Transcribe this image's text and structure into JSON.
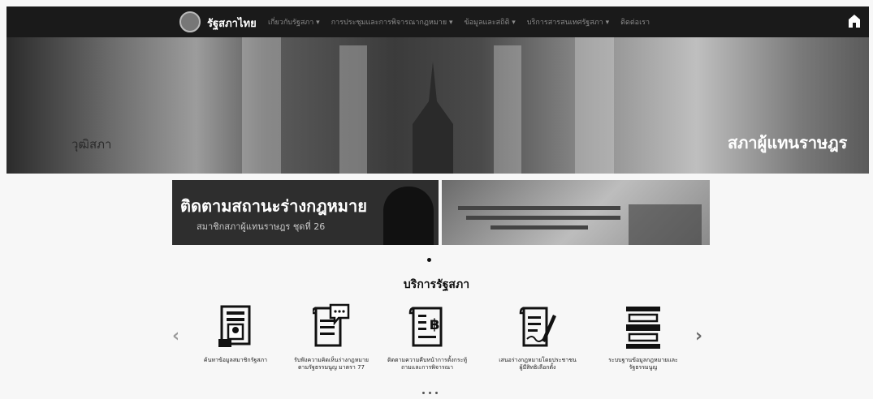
{
  "header": {
    "site_name": "รัฐสภาไทย",
    "nav": [
      "เกี่ยวกับรัฐสภา ▾",
      "การประชุมและการพิจารณากฎหมาย ▾",
      "ข้อมูลและสถิติ ▾",
      "บริการสารสนเทศรัฐสภา ▾",
      "ติดต่อเรา"
    ],
    "icons": {
      "logo": "parliament-logo-icon",
      "home": "home-icon"
    }
  },
  "hero": {
    "left_label": "วุฒิสภา",
    "right_label": "สภาผู้แทนราษฎร"
  },
  "banners": [
    {
      "title": "ติดตามสถานะร่างกฎหมาย",
      "subtitle": "สมาชิกสภาผู้แทนราษฎร ชุดที่ 26"
    },
    {
      "title": ""
    }
  ],
  "services": {
    "title": "บริการรัฐสภา",
    "items": [
      {
        "label": "ค้นหาข้อมูลสมาชิกรัฐสภา",
        "icon": "member-card-icon"
      },
      {
        "label": "รับฟังความคิดเห็นร่างกฎหมาย ตามรัฐธรรมนูญ มาตรา 77",
        "icon": "document-comment-icon"
      },
      {
        "label": "ติดตามความคืบหน้าการตั้งกระทู้ ถามและการพิจารณา",
        "icon": "document-money-icon"
      },
      {
        "label": "เสนอร่างกฎหมายโดยประชาชน ผู้มีสิทธิเลือกตั้ง",
        "icon": "document-sign-icon"
      },
      {
        "label": "ระบบฐานข้อมูลกฎหมายและรัฐธรรมนูญ",
        "icon": "bookshelf-icon"
      }
    ],
    "prev_label": "‹",
    "next_label": "›"
  }
}
